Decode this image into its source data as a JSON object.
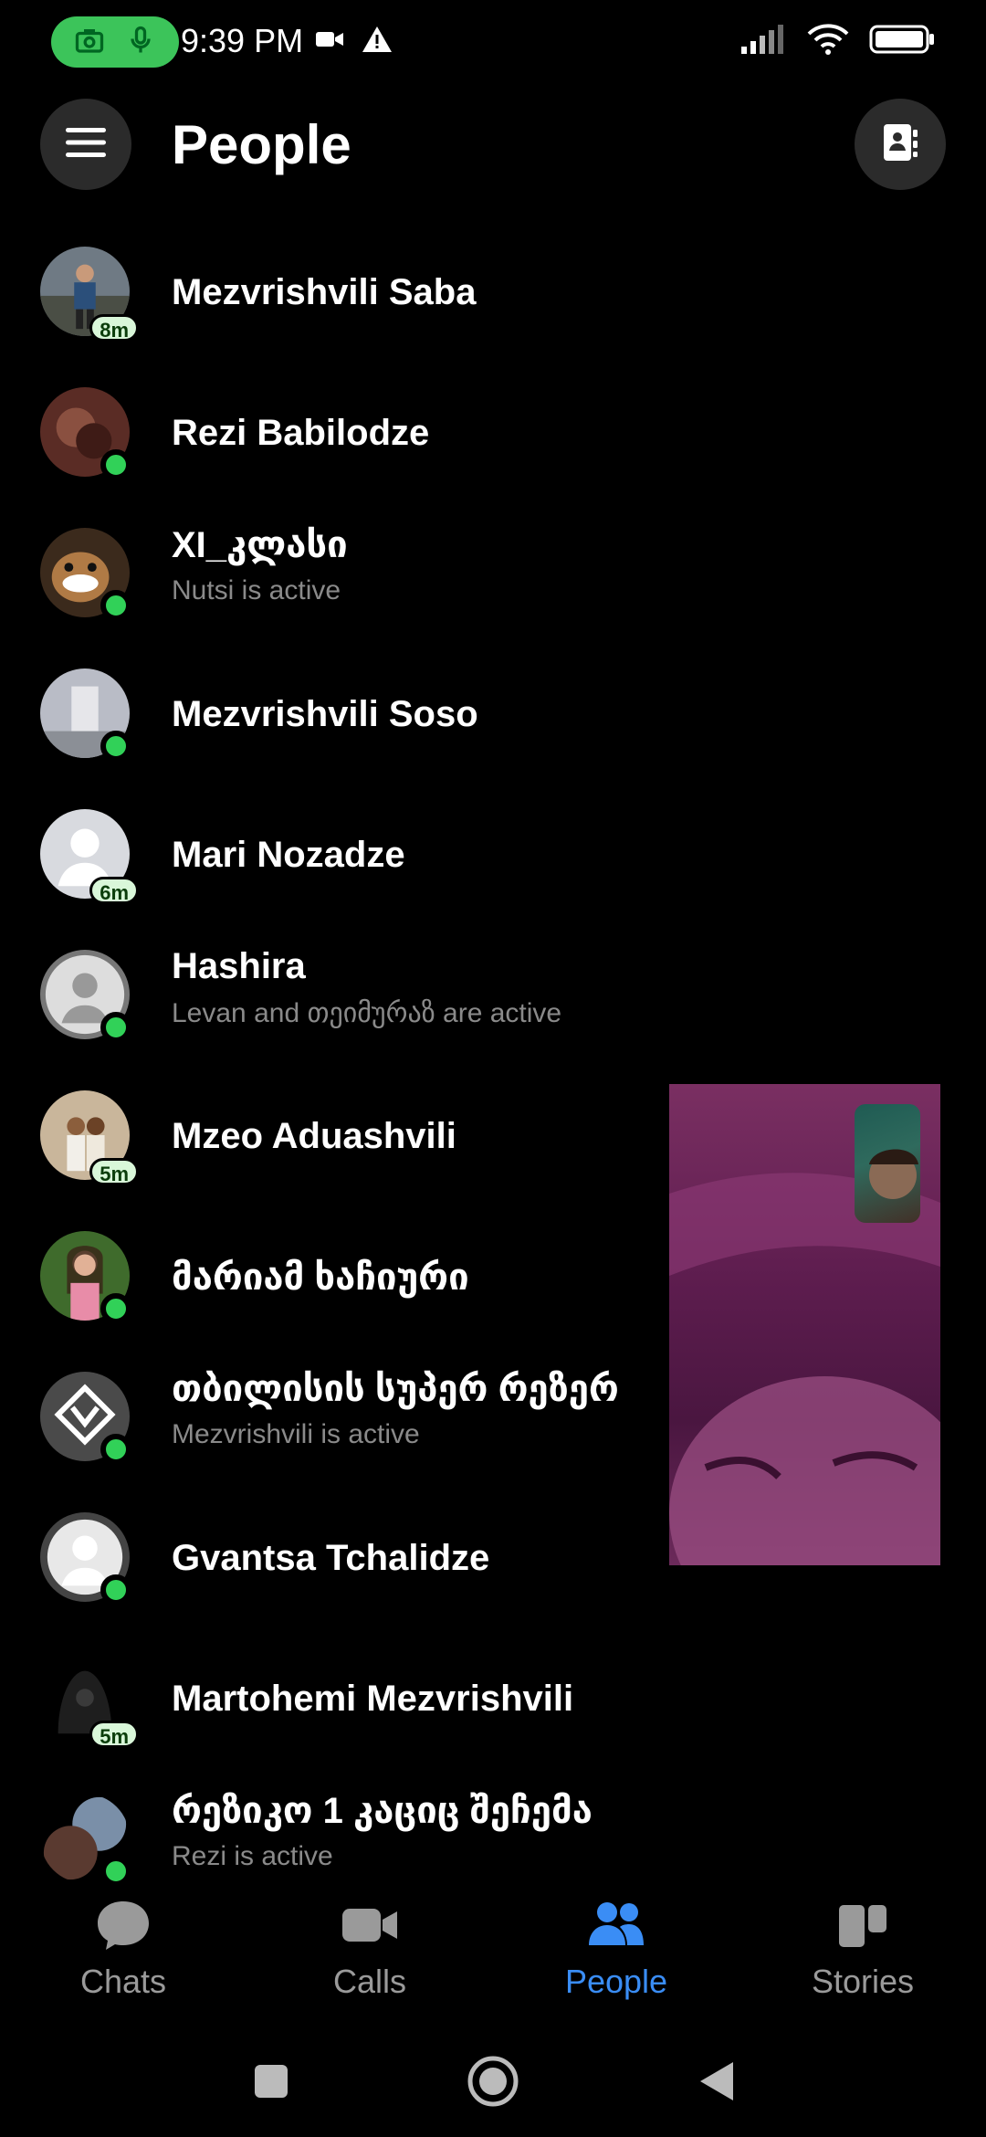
{
  "status_bar": {
    "time": "9:39 PM",
    "left_icons": [
      "camera-icon",
      "mic-icon",
      "video-icon",
      "warning-icon"
    ],
    "right_icons": [
      "signal-icon",
      "wifi-icon",
      "battery-icon"
    ]
  },
  "header": {
    "title": "People"
  },
  "people": [
    {
      "name": "Mezvrishvili Saba",
      "subtitle": "",
      "badge": "8m",
      "online": false
    },
    {
      "name": "Rezi Babilodze",
      "subtitle": "",
      "badge": "",
      "online": true
    },
    {
      "name": "XI_კლასი",
      "subtitle": "Nutsi is active",
      "badge": "",
      "online": true
    },
    {
      "name": "Mezvrishvili Soso",
      "subtitle": "",
      "badge": "",
      "online": true
    },
    {
      "name": "Mari Nozadze",
      "subtitle": "",
      "badge": "6m",
      "online": false
    },
    {
      "name": "Hashira",
      "subtitle": "Levan and თეიმურაზ are active",
      "badge": "",
      "online": true
    },
    {
      "name": "Mzeo Aduashvili",
      "subtitle": "",
      "badge": "5m",
      "online": false
    },
    {
      "name": "მარიამ ხაჩიური",
      "subtitle": "",
      "badge": "",
      "online": true
    },
    {
      "name": "თბილისის სუპერ რეზერ",
      "subtitle": "Mezvrishvili is active",
      "badge": "",
      "online": true
    },
    {
      "name": "Gvantsa Tchalidze",
      "subtitle": "",
      "badge": "",
      "online": true
    },
    {
      "name": "Martohemi Mezvrishvili",
      "subtitle": "",
      "badge": "5m",
      "online": false
    },
    {
      "name": "რეზიკო 1 კაციც შეჩემა",
      "subtitle": "Rezi is active",
      "badge": "",
      "online": true
    }
  ],
  "bottom_nav": {
    "items": [
      {
        "label": "Chats",
        "icon": "chat-bubble-icon",
        "active": false
      },
      {
        "label": "Calls",
        "icon": "video-camera-icon",
        "active": false
      },
      {
        "label": "People",
        "icon": "people-icon",
        "active": true
      },
      {
        "label": "Stories",
        "icon": "stories-icon",
        "active": false
      }
    ]
  },
  "colors": {
    "background": "#000000",
    "accent": "#3a8df5",
    "online": "#31d158",
    "recording_pill": "#3cc45a",
    "subtitle": "#8a8a8a"
  }
}
